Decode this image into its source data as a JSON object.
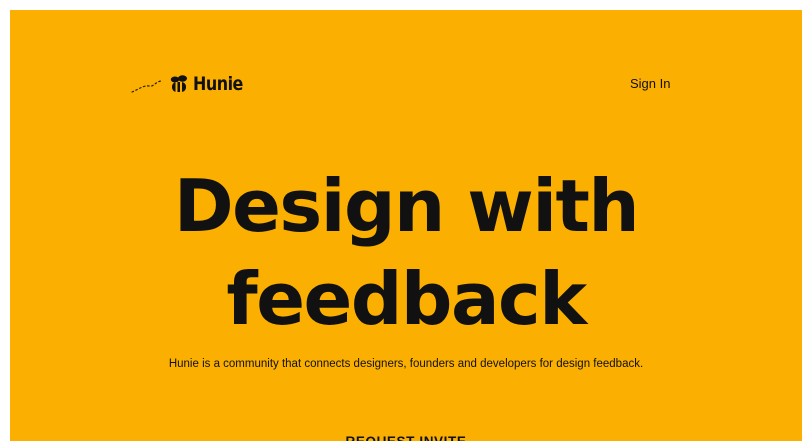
{
  "theme": {
    "background": "#FBAF00",
    "text": "#111111"
  },
  "header": {
    "brand": {
      "name": "Hunie",
      "icon": "bee-icon",
      "trail_icon": "flight-trail-icon"
    },
    "sign_in_label": "Sign In"
  },
  "hero": {
    "headline_lines": [
      "Design with",
      "feedback"
    ],
    "tagline": "Hunie is a community that connects designers, founders and developers for design feedback.",
    "cta_label": "REQUEST INVITE"
  }
}
